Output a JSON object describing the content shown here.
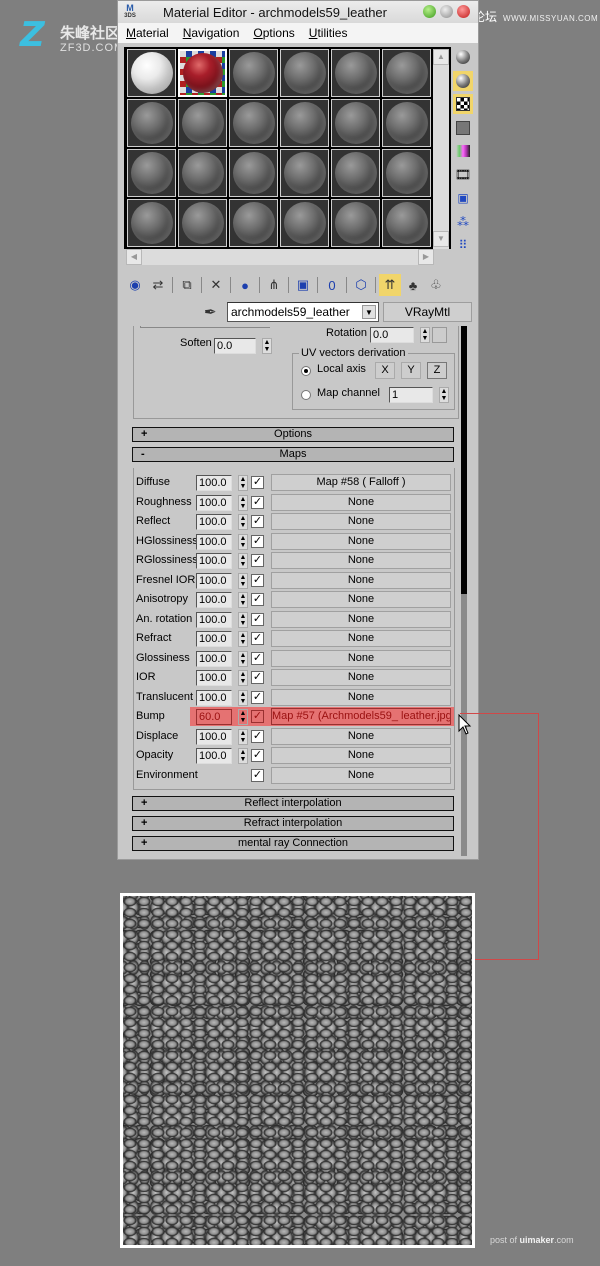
{
  "watermarks": {
    "top_left_cn": "朱峰社区",
    "top_left_en": "ZF3D.COM",
    "top_right_cn": "思缘设计论坛",
    "top_right_site": "WWW.MISSYUAN.COM",
    "bottom_prefix": "post of ",
    "bottom_brand": "uimaker",
    "bottom_suffix": ".com"
  },
  "window": {
    "app_icon_letter": "M",
    "app_icon_sub": "3DS",
    "title": "Material Editor - archmodels59_leather"
  },
  "menu": [
    {
      "label": "Material",
      "accel": "M",
      "rest": "aterial"
    },
    {
      "label": "Navigation",
      "accel": "N",
      "rest": "avigation"
    },
    {
      "label": "Options",
      "accel": "O",
      "rest": "ptions"
    },
    {
      "label": "Utilities",
      "accel": "U",
      "rest": "tilities"
    }
  ],
  "sample_slots": {
    "rows": 4,
    "cols": 6,
    "active_index": 1,
    "white_index": 0
  },
  "side_tools": [
    {
      "name": "sample-type-icon",
      "active": false
    },
    {
      "name": "backlight-icon",
      "active": true
    },
    {
      "name": "background-checker-icon",
      "active": true
    },
    {
      "name": "uv-tiling-icon",
      "active": false
    },
    {
      "name": "video-color-check-icon",
      "active": false
    },
    {
      "name": "make-preview-icon",
      "active": false
    },
    {
      "name": "options-icon",
      "active": false
    },
    {
      "name": "select-by-material-icon",
      "active": false
    },
    {
      "name": "material-map-navigator-icon",
      "active": false
    }
  ],
  "toolbar": [
    {
      "name": "get-material-icon",
      "glyph": "◉"
    },
    {
      "name": "put-to-scene-icon",
      "glyph": "⇄"
    },
    {
      "name": "assign-to-selection-icon",
      "glyph": "⧉"
    },
    {
      "name": "reset-map-icon",
      "glyph": "✕"
    },
    {
      "name": "make-copy-icon",
      "glyph": "●"
    },
    {
      "name": "make-unique-icon",
      "glyph": "⋔"
    },
    {
      "name": "put-to-library-icon",
      "glyph": "▣"
    },
    {
      "name": "material-effects-channel-icon",
      "glyph": "0"
    },
    {
      "name": "show-map-in-viewport-icon",
      "glyph": "⬡"
    },
    {
      "name": "show-end-result-icon",
      "glyph": "⇈"
    },
    {
      "name": "go-to-parent-icon",
      "glyph": "♣"
    },
    {
      "name": "go-forward-to-sibling-icon",
      "glyph": "♧"
    }
  ],
  "material": {
    "name": "archmodels59_leather",
    "type": "VRayMtl"
  },
  "brdf": {
    "soften_label": "Soften",
    "soften_value": "0.0",
    "rotation_label": "Rotation",
    "rotation_value": "0.0",
    "uv_group_label": "UV vectors derivation",
    "local_axis_label": "Local axis",
    "local_axis_selected": true,
    "axis_buttons": [
      "X",
      "Y",
      "Z"
    ],
    "map_channel_label": "Map channel",
    "map_channel_value": "1"
  },
  "rollouts": {
    "options": {
      "sign": "+",
      "label": "Options"
    },
    "maps": {
      "sign": "-",
      "label": "Maps"
    },
    "reflect_interp": {
      "sign": "+",
      "label": "Reflect interpolation"
    },
    "refract_interp": {
      "sign": "+",
      "label": "Refract interpolation"
    },
    "mental_ray": {
      "sign": "+",
      "label": "mental ray Connection"
    }
  },
  "maps": [
    {
      "name": "Diffuse",
      "amount": "100.0",
      "enabled": true,
      "map": "Map #58  ( Falloff )"
    },
    {
      "name": "Roughness",
      "amount": "100.0",
      "enabled": true,
      "map": "None"
    },
    {
      "name": "Reflect",
      "amount": "100.0",
      "enabled": true,
      "map": "None"
    },
    {
      "name": "HGlossiness",
      "amount": "100.0",
      "enabled": true,
      "map": "None"
    },
    {
      "name": "RGlossiness",
      "amount": "100.0",
      "enabled": true,
      "map": "None"
    },
    {
      "name": "Fresnel IOR",
      "amount": "100.0",
      "enabled": true,
      "map": "None"
    },
    {
      "name": "Anisotropy",
      "amount": "100.0",
      "enabled": true,
      "map": "None"
    },
    {
      "name": "An. rotation",
      "amount": "100.0",
      "enabled": true,
      "map": "None"
    },
    {
      "name": "Refract",
      "amount": "100.0",
      "enabled": true,
      "map": "None"
    },
    {
      "name": "Glossiness",
      "amount": "100.0",
      "enabled": true,
      "map": "None"
    },
    {
      "name": "IOR",
      "amount": "100.0",
      "enabled": true,
      "map": "None"
    },
    {
      "name": "Translucent",
      "amount": "100.0",
      "enabled": true,
      "map": "None"
    },
    {
      "name": "Bump",
      "amount": "60.0",
      "enabled": true,
      "map": "Map #57 (Archmodels59_ leather.jpg)",
      "highlighted": true
    },
    {
      "name": "Displace",
      "amount": "100.0",
      "enabled": true,
      "map": "None"
    },
    {
      "name": "Opacity",
      "amount": "100.0",
      "enabled": true,
      "map": "None"
    },
    {
      "name": "Environment",
      "amount": null,
      "enabled": true,
      "map": "None"
    }
  ],
  "highlight_color": "#eb5f5f",
  "connector_color": "#d04848"
}
